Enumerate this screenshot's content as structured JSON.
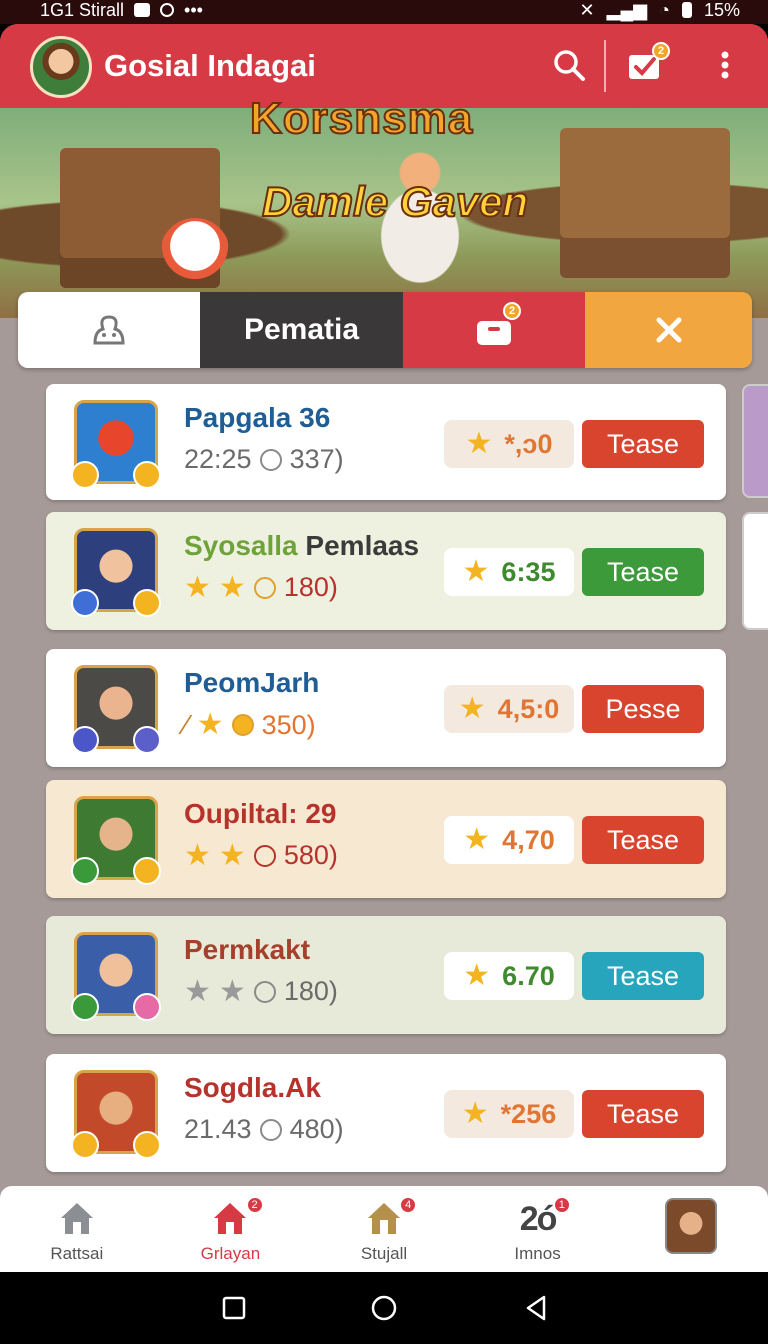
{
  "status_bar": {
    "left_text": "1G1 Stirall",
    "right_text": "15%"
  },
  "header": {
    "title": "Gosial Indagai",
    "inbox_badge": "2"
  },
  "banner": {
    "top_text": "Korsnsma",
    "title": "Damle Gaven"
  },
  "tabs": [
    {
      "label": ""
    },
    {
      "label": "Pematia"
    },
    {
      "label": "",
      "badge": "2"
    },
    {
      "label": ""
    }
  ],
  "cards": [
    {
      "name": "Papgala 36",
      "sub_left": "22:25",
      "coin_value": "337)",
      "score": "*,ɔ0",
      "button": "Tease",
      "bg": "#ffffff",
      "name_color": "#1e5d95",
      "score_color": "#e07534",
      "btn_color": "#d8442e"
    },
    {
      "name_a": "Syosalla",
      "name_b": " Pemlaas",
      "coin_value": "180)",
      "score": "6:35",
      "button": "Tease",
      "bg": "#eef1df",
      "name_color": "#6ea33a",
      "score_color": "#3f8a2e",
      "btn_color": "#3c9a3b"
    },
    {
      "name": "PeomJarh",
      "coin_value": "350)",
      "score": "4,5:0",
      "button": "Pesse",
      "bg": "#ffffff",
      "name_color": "#1e5d95",
      "score_color": "#e07534",
      "btn_color": "#d8442e"
    },
    {
      "name": "Oupiltal: 29",
      "coin_value": "580)",
      "score": "4,70",
      "button": "Tease",
      "bg": "#f7e8d2",
      "name_color": "#b6332b",
      "score_color": "#e07534",
      "btn_color": "#d8442e"
    },
    {
      "name": "Permkakt",
      "coin_value": "180)",
      "score": "6.70",
      "button": "Tease",
      "bg": "#e7ead9",
      "name_color": "#a4402b",
      "score_color": "#3f8a2e",
      "btn_color": "#27a5bd"
    },
    {
      "name": "Sogdla.Ak",
      "sub_left": "21.43",
      "coin_value": "480)",
      "score": "*256",
      "button": "Tease",
      "bg": "#ffffff",
      "name_color": "#b6332b",
      "score_color": "#e07534",
      "btn_color": "#d8442e"
    }
  ],
  "bottom_nav": [
    {
      "label": "Rattsai"
    },
    {
      "label": "Grlayan",
      "badge": "2"
    },
    {
      "label": "Stujall",
      "badge": "4"
    },
    {
      "label": "Imnos",
      "number": "2ó",
      "badge": "1"
    },
    {
      "label": ""
    }
  ]
}
